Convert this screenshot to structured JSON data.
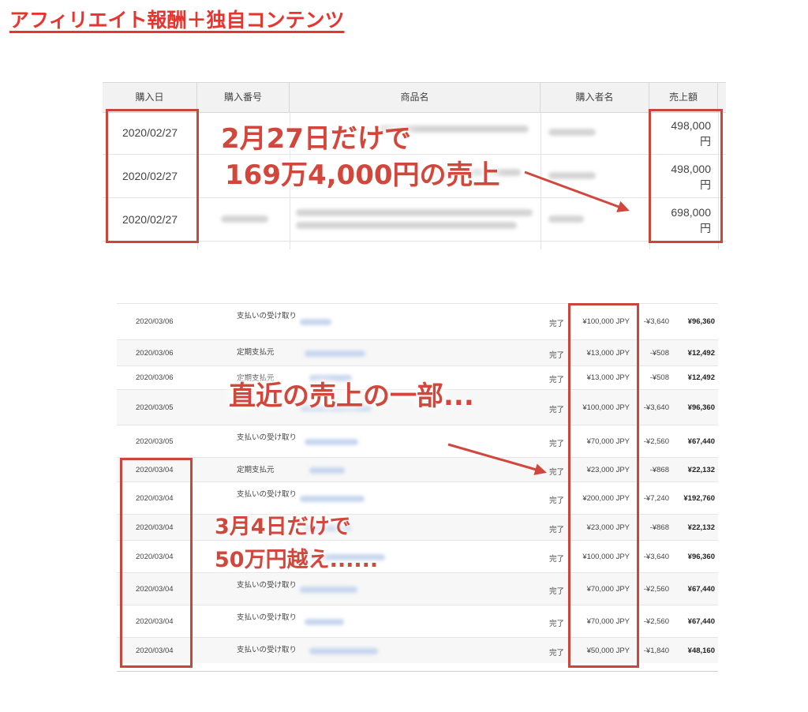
{
  "title": "アフィリエイト報酬＋独自コンテンツ",
  "table1": {
    "headers": [
      "購入日",
      "購入番号",
      "商品名",
      "購入者名",
      "売上額"
    ],
    "rows": [
      {
        "date": "2020/02/27",
        "amount": "498,000",
        "unit": "円"
      },
      {
        "date": "2020/02/27",
        "amount": "498,000",
        "unit": "円"
      },
      {
        "date": "2020/02/27",
        "amount": "698,000",
        "unit": "円"
      }
    ],
    "annotation_line1": "2月27日だけで",
    "annotation_line2": "169万4,000円の売上"
  },
  "table2": {
    "rows": [
      {
        "date": "2020/03/06",
        "type": "支払いの受け取り",
        "status": "完了",
        "gross": "¥100,000 JPY",
        "fee": "-¥3,640",
        "net": "¥96,360"
      },
      {
        "date": "2020/03/06",
        "type": "定期支払元",
        "status": "完了",
        "gross": "¥13,000 JPY",
        "fee": "-¥508",
        "net": "¥12,492"
      },
      {
        "date": "2020/03/06",
        "type": "定期支払元",
        "status": "完了",
        "gross": "¥13,000 JPY",
        "fee": "-¥508",
        "net": "¥12,492"
      },
      {
        "date": "2020/03/05",
        "type": "",
        "status": "完了",
        "gross": "¥100,000 JPY",
        "fee": "-¥3,640",
        "net": "¥96,360"
      },
      {
        "date": "2020/03/05",
        "type": "支払いの受け取り",
        "status": "完了",
        "gross": "¥70,000 JPY",
        "fee": "-¥2,560",
        "net": "¥67,440"
      },
      {
        "date": "2020/03/04",
        "type": "定期支払元",
        "status": "完了",
        "gross": "¥23,000 JPY",
        "fee": "-¥868",
        "net": "¥22,132"
      },
      {
        "date": "2020/03/04",
        "type": "支払いの受け取り",
        "status": "完了",
        "gross": "¥200,000 JPY",
        "fee": "-¥7,240",
        "net": "¥192,760"
      },
      {
        "date": "2020/03/04",
        "type": "",
        "status": "完了",
        "gross": "¥23,000 JPY",
        "fee": "-¥868",
        "net": "¥22,132"
      },
      {
        "date": "2020/03/04",
        "type": "",
        "status": "完了",
        "gross": "¥100,000 JPY",
        "fee": "-¥3,640",
        "net": "¥96,360"
      },
      {
        "date": "2020/03/04",
        "type": "支払いの受け取り",
        "status": "完了",
        "gross": "¥70,000 JPY",
        "fee": "-¥2,560",
        "net": "¥67,440"
      },
      {
        "date": "2020/03/04",
        "type": "支払いの受け取り",
        "status": "完了",
        "gross": "¥70,000 JPY",
        "fee": "-¥2,560",
        "net": "¥67,440"
      },
      {
        "date": "2020/03/04",
        "type": "支払いの受け取り",
        "status": "完了",
        "gross": "¥50,000 JPY",
        "fee": "-¥1,840",
        "net": "¥48,160"
      }
    ],
    "annotation_recent": "直近の売上の一部...",
    "annotation_march_line1": "3月4日だけで",
    "annotation_march_line2": "50万円越え......"
  },
  "colors": {
    "title": "#e8342e",
    "highlight_box": "#c9473a",
    "annotation_text": "#d2473c"
  }
}
